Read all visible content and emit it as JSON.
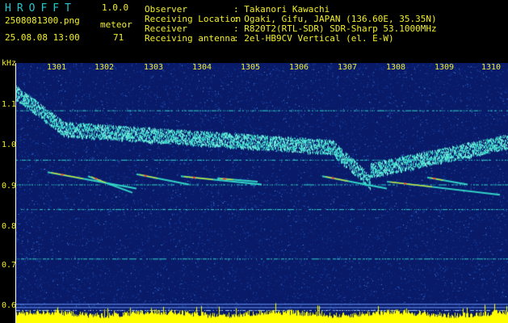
{
  "header": {
    "app_title": "HROFFT",
    "version": "1.0.0",
    "filename": "2508081300.png",
    "mode": "meteor",
    "datetime": "25.08.08 13:00",
    "count": "71",
    "observer_label": "Observer",
    "observer_value": ": Takanori Kawachi",
    "location_label": "Receiving Location",
    "location_value": ": Ogaki, Gifu, JAPAN (136.60E, 35.35N)",
    "receiver_label": "Receiver",
    "receiver_value": ": R820T2(RTL-SDR) SDR-Sharp 53.1000MHz",
    "antenna_label": "Receiving antenna",
    "antenna_value": ": 2el-HB9CV Vertical (el. E-W)"
  },
  "chart_data": {
    "type": "heatmap",
    "yunit": "kHz",
    "y_ticks": [
      "1.1",
      "1.0",
      "0.9",
      "0.8",
      "0.7",
      "0.6"
    ],
    "x_ticks": [
      "1301",
      "1302",
      "1303",
      "1304",
      "1305",
      "1306",
      "1307",
      "1308",
      "1309",
      "1310"
    ],
    "ylim": [
      0.6,
      1.18
    ],
    "colors": {
      "background": "#081a68",
      "noise": "#2a62c8",
      "trace": "#32d6c8",
      "echo": "#ffe000",
      "echo_core": "#ff3a3a",
      "level_bar": "#ffff00"
    }
  }
}
